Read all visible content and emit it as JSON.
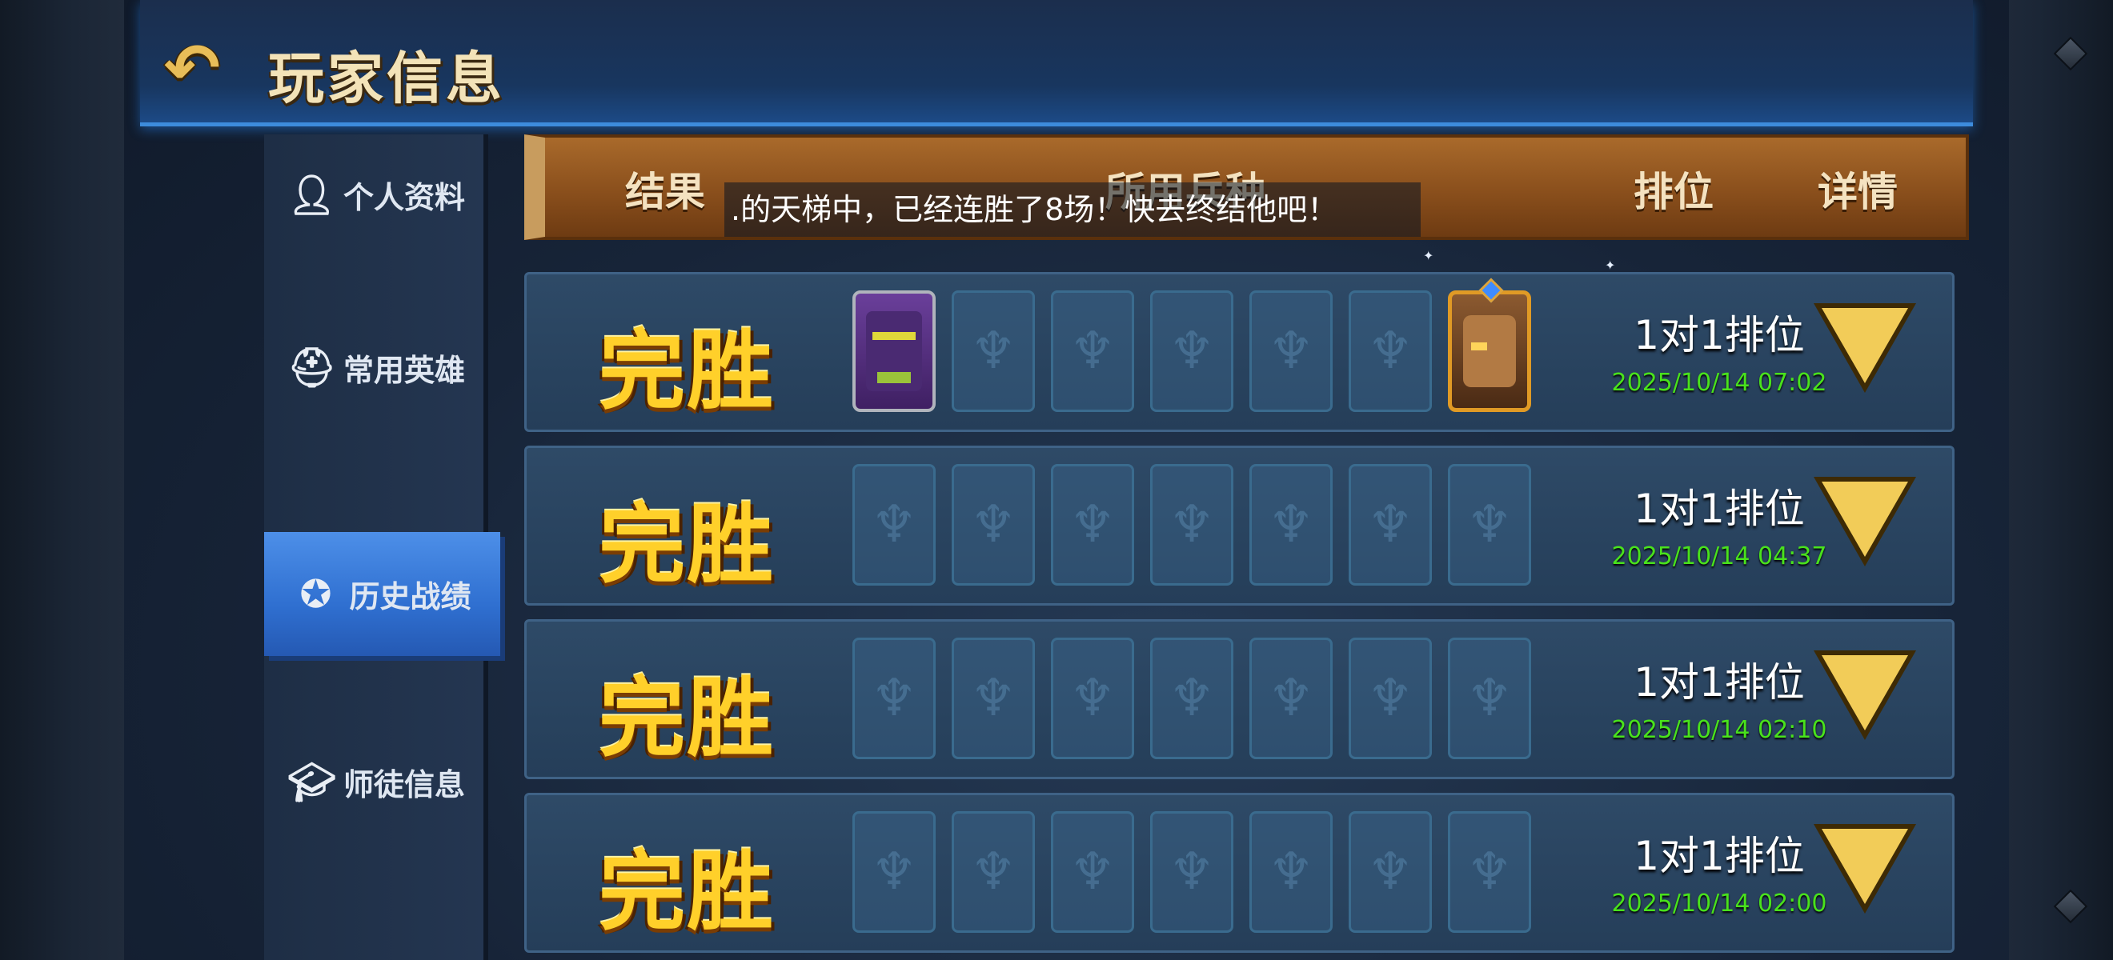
{
  "header": {
    "title": "玩家信息",
    "back_icon": "back-arrow-icon"
  },
  "sidebar": {
    "items": [
      {
        "label": "个人资料",
        "icon": "person-icon",
        "active": false
      },
      {
        "label": "常用英雄",
        "icon": "helmet-icon",
        "active": false
      },
      {
        "label": "历史战绩",
        "icon": "medal-icon",
        "active": true
      },
      {
        "label": "师徒信息",
        "icon": "graduation-cap-icon",
        "active": false
      }
    ]
  },
  "table": {
    "columns": {
      "result": "结果",
      "units": "所用兵种",
      "rank": "排位",
      "detail": "详情"
    }
  },
  "ticker": {
    "text": ".的天梯中，已经连胜了8场！快去终结他吧！"
  },
  "matches": [
    {
      "result": "完胜",
      "mode": "1对1排位",
      "time": "2025/10/14 07:02"
    },
    {
      "result": "完胜",
      "mode": "1对1排位",
      "time": "2025/10/14 04:37"
    },
    {
      "result": "完胜",
      "mode": "1对1排位",
      "time": "2025/10/14 02:10"
    },
    {
      "result": "完胜",
      "mode": "1对1排位",
      "time": "2025/10/14 02:00"
    }
  ],
  "colors": {
    "win_text": "#ffd02a",
    "time_text": "#49e21c",
    "active_tab": "#3a7ce0",
    "header_bar": "#8a4f1c"
  }
}
